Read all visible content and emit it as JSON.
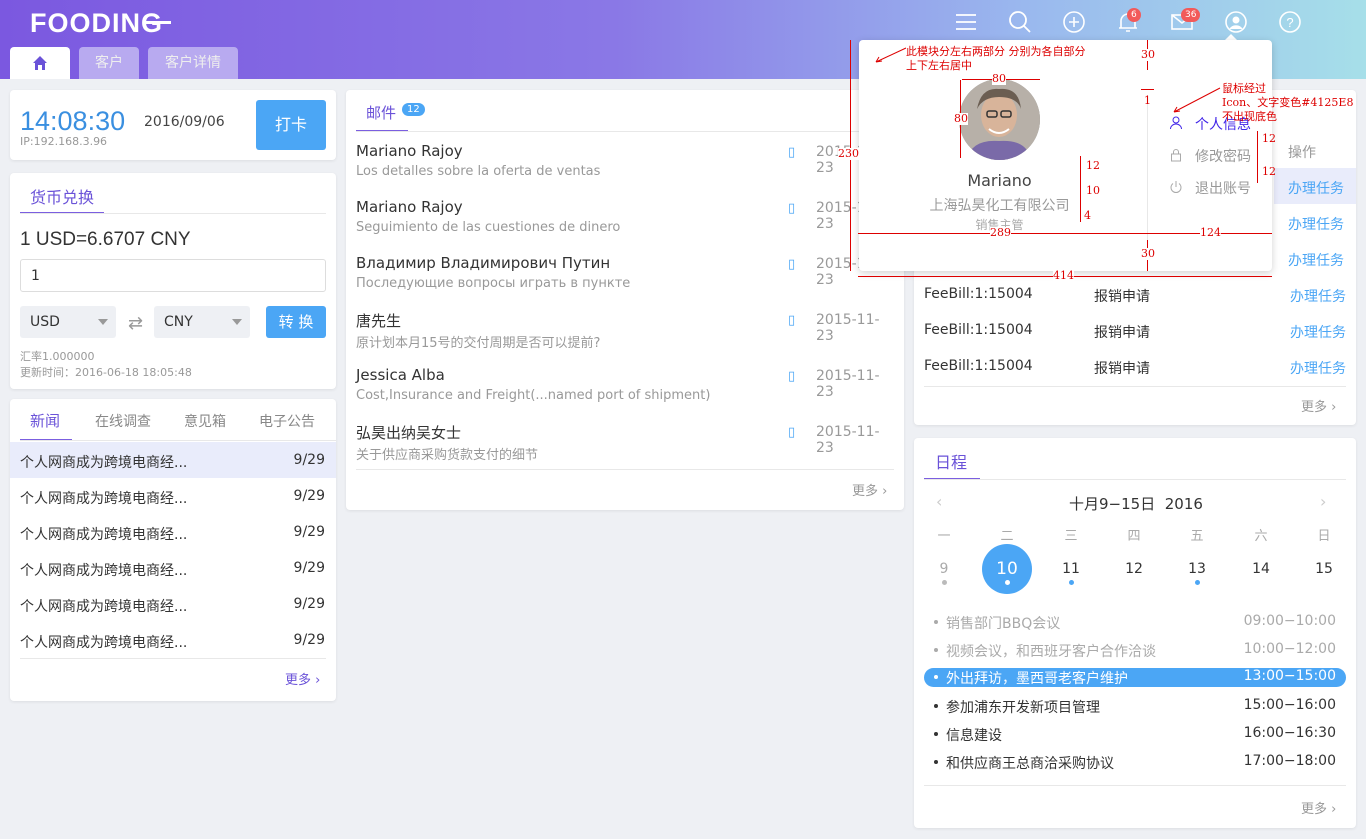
{
  "header": {
    "logo": "FOODING",
    "tabs": [
      {
        "label": "客户"
      },
      {
        "label": "客户详情"
      }
    ],
    "bell_badge": "6",
    "mail_badge": "36"
  },
  "clock": {
    "time": "14:08:30",
    "date": "2016/09/06",
    "ip": "IP:192.168.3.96",
    "punch_label": "打卡"
  },
  "currency": {
    "title": "货币兑换",
    "rate_line": "1 USD=6.6707 CNY",
    "amount": "1",
    "from": "USD",
    "to": "CNY",
    "convert_label": "转 换",
    "rate_meta": "汇率1.000000",
    "updated": "更新时间：2016-06-18 18:05:48"
  },
  "news": {
    "tabs": [
      "新闻",
      "在线调查",
      "意见箱",
      "电子公告"
    ],
    "rows": [
      {
        "title": "个人网商成为跨境电商经...",
        "date": "9/29"
      },
      {
        "title": "个人网商成为跨境电商经...",
        "date": "9/29"
      },
      {
        "title": "个人网商成为跨境电商经...",
        "date": "9/29"
      },
      {
        "title": "个人网商成为跨境电商经...",
        "date": "9/29"
      },
      {
        "title": "个人网商成为跨境电商经...",
        "date": "9/29"
      },
      {
        "title": "个人网商成为跨境电商经...",
        "date": "9/29"
      }
    ],
    "more": "更多"
  },
  "mail": {
    "title": "邮件",
    "count": "12",
    "items": [
      {
        "sender": "Mariano Rajoy",
        "subject": "Los detalles sobre la oferta de ventas",
        "date": "2015-11-23"
      },
      {
        "sender": "Mariano Rajoy",
        "subject": "Seguimiento de las cuestiones de dinero",
        "date": "2015-11-23"
      },
      {
        "sender": "Владимир Владимирович Путин",
        "subject": "Последующие  вопросы  играть в  пункте",
        "date": "2015-11-23"
      },
      {
        "sender": "唐先生",
        "subject": "原计划本月15号的交付周期是否可以提前?",
        "date": "2015-11-23"
      },
      {
        "sender": "Jessica Alba",
        "subject": "Cost,Insurance and Freight(...named port of shipment)",
        "date": "2015-11-23"
      },
      {
        "sender": "弘昊出纳吴女士",
        "subject": "关于供应商采购货款支付的细节",
        "date": "2015-11-23"
      }
    ],
    "more": "更多"
  },
  "tasks": {
    "op_header": "操作",
    "rows": [
      {
        "id": "FeeBill:1:15004",
        "type": "报销申请",
        "action": "办理任务"
      },
      {
        "id": "FeeBill:1:15004",
        "type": "报销申请",
        "action": "办理任务"
      },
      {
        "id": "FeeBill:1:15004",
        "type": "报销申请",
        "action": "办理任务"
      }
    ],
    "hidden_actions": [
      "办理任务",
      "办理任务",
      "办理任务"
    ],
    "more": "更多"
  },
  "schedule": {
    "title": "日程",
    "range": "十月9−15日",
    "year": "2016",
    "weekdays": [
      "一",
      "二",
      "三",
      "四",
      "五",
      "六",
      "日"
    ],
    "days": [
      "9",
      "10",
      "11",
      "12",
      "13",
      "14",
      "15"
    ],
    "events": [
      {
        "name": "销售部门BBQ会议",
        "time": "09:00−10:00",
        "state": "past"
      },
      {
        "name": "视频会议，和西班牙客户合作洽谈",
        "time": "10:00−12:00",
        "state": "past"
      },
      {
        "name": "外出拜访，墨西哥老客户维护",
        "time": "13:00−15:00",
        "state": "current"
      },
      {
        "name": "参加浦东开发新项目管理",
        "time": "15:00−16:00",
        "state": "future"
      },
      {
        "name": "信息建设",
        "time": "16:00−16:30",
        "state": "future"
      },
      {
        "name": "和供应商王总商洽采购协议",
        "time": "17:00−18:00",
        "state": "future"
      }
    ],
    "more": "更多"
  },
  "profile": {
    "name": "Mariano",
    "company": "上海弘昊化工有限公司",
    "role": "销售主管",
    "menu": [
      "个人信息",
      "修改密码",
      "退出账号"
    ]
  },
  "annotations": {
    "note1": "此模块分左右两部分 分别为各自部分",
    "note2": "上下左右居中",
    "note3": "鼠标经过",
    "note4": "Icon、文字变色#4125E8",
    "note5": "不出现底色",
    "m80a": "80",
    "m80b": "80",
    "m230": "230",
    "m30a": "30",
    "m1": "1",
    "m12a": "12",
    "m10": "10",
    "m4": "4",
    "m12b": "12",
    "m12c": "12",
    "m289": "289",
    "m124": "124",
    "m30b": "30",
    "m414": "414"
  },
  "colors": {
    "accent": "#4ba6f5",
    "purple": "#6a52d8",
    "hover": "#4125E8",
    "annotation": "#dd0000"
  }
}
